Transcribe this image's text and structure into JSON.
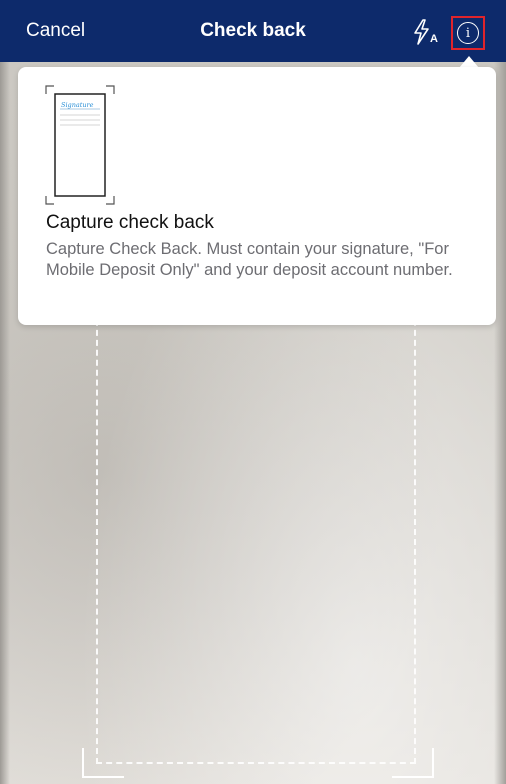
{
  "header": {
    "cancel_label": "Cancel",
    "title": "Check back",
    "flash_icon": "flash-auto-icon",
    "info_icon": "info-icon",
    "background_color": "#0d2a6b",
    "highlight_color": "#e0242b"
  },
  "popover": {
    "illustration_label": "Signature",
    "title": "Capture check back",
    "body": "Capture Check Back.  Must contain your signature, \"For Mobile Deposit Only\" and your deposit account number."
  }
}
